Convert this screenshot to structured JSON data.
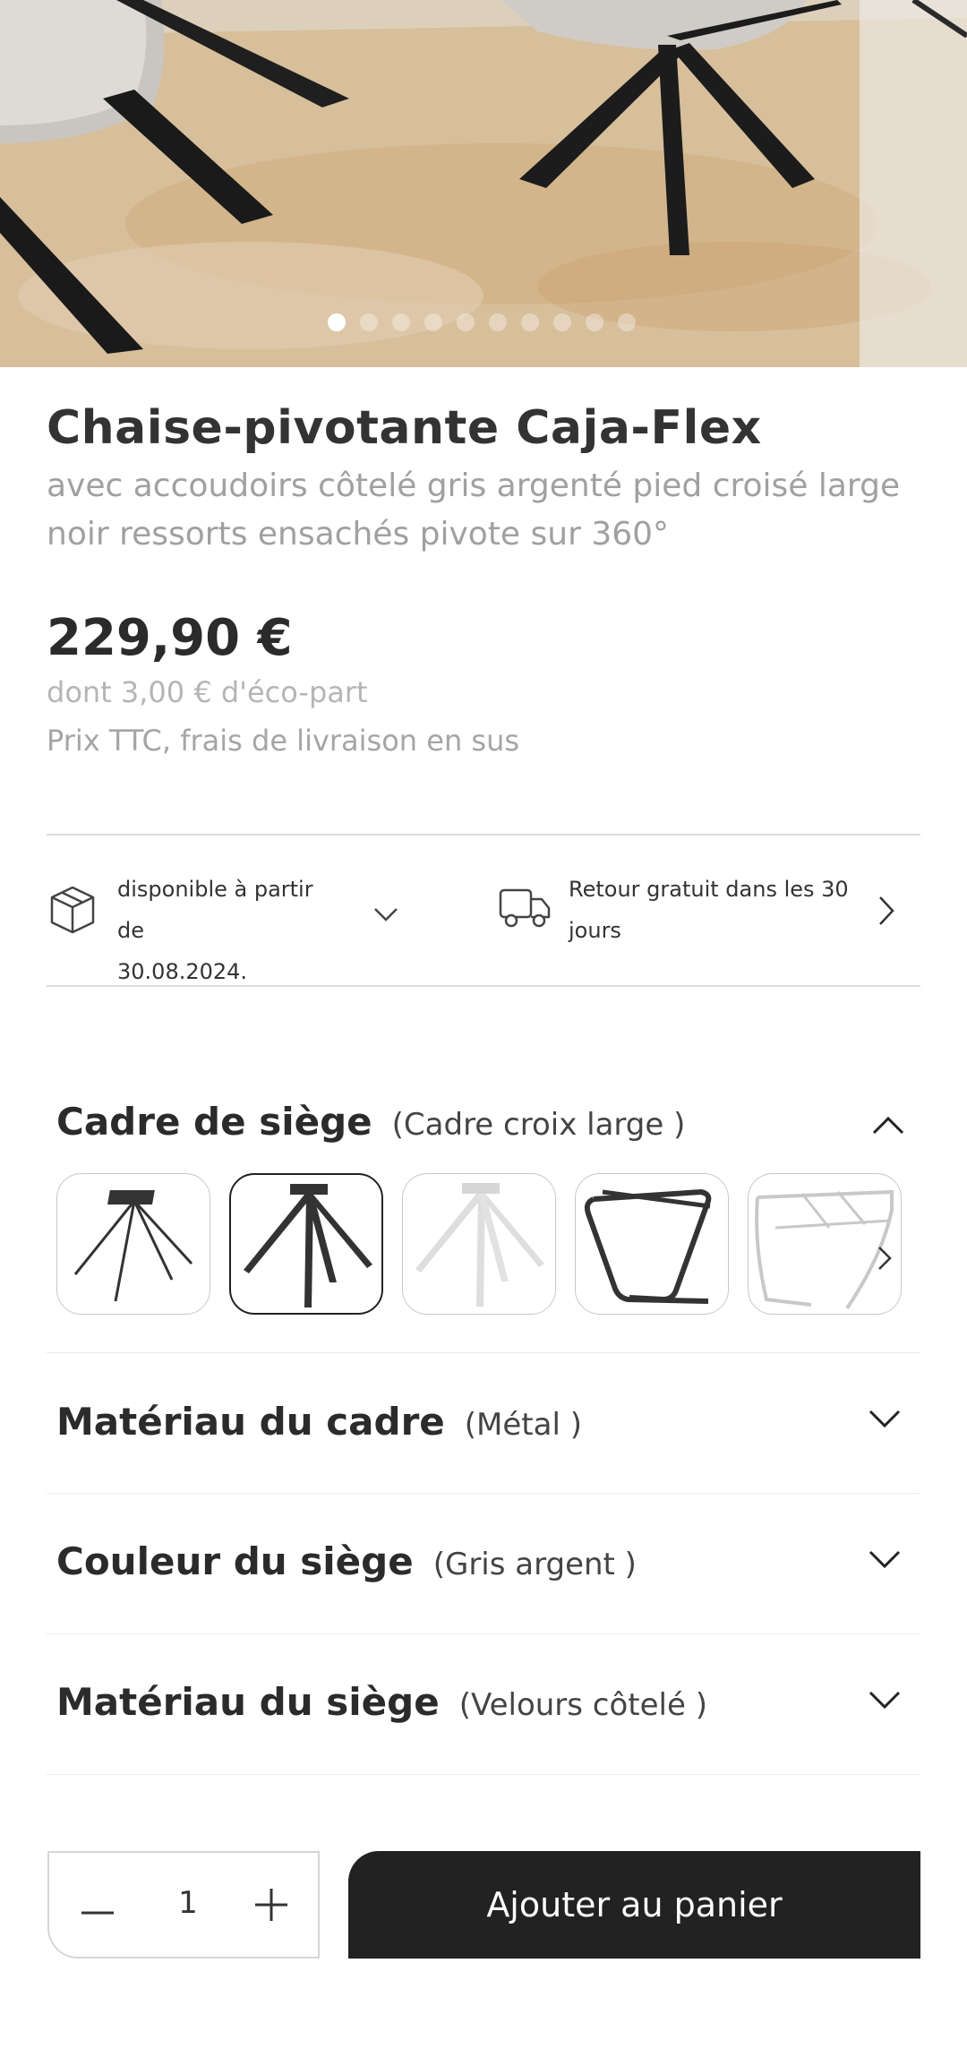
{
  "product": {
    "title": "Chaise-pivotante Caja-Flex",
    "subtitle": "avec accoudoirs côtelé gris argenté pied croisé large noir ressorts ensachés pivote sur 360°",
    "price": "229,90 €",
    "eco_part": "dont 3,00 € d'éco-part",
    "tax_note": "Prix TTC, frais de livraison en sus"
  },
  "gallery": {
    "image_count": 10,
    "active_index": 0
  },
  "info": {
    "availability_line1": "disponible à partir de",
    "availability_line2": "30.08.2024.",
    "return_line1": "Retour gratuit dans les 30",
    "return_line2": "jours"
  },
  "options": [
    {
      "label": "Cadre de siège",
      "value": "(Cadre croix large )",
      "expanded": true
    },
    {
      "label": "Matériau du cadre",
      "value": "(Métal )",
      "expanded": false
    },
    {
      "label": "Couleur du siège",
      "value": "(Gris argent )",
      "expanded": false
    },
    {
      "label": "Matériau du siège",
      "value": "(Velours côtelé )",
      "expanded": false
    }
  ],
  "frame_swatches": [
    {
      "name": "cross-thin-black",
      "selected": false
    },
    {
      "name": "cross-wide-black",
      "selected": true
    },
    {
      "name": "cross-wide-white",
      "selected": false
    },
    {
      "name": "cantilever-black",
      "selected": false
    },
    {
      "name": "sled-white",
      "selected": false
    }
  ],
  "cart": {
    "quantity": "1",
    "add_label": "Ajouter au panier"
  },
  "icons": [
    "box-icon",
    "truck-icon",
    "chevron-down-icon",
    "chevron-right-icon",
    "chevron-up-icon",
    "minus-icon",
    "plus-icon"
  ],
  "colors": {
    "primary": "#222222",
    "muted_text": "#a0a0a0",
    "border": "#dcdcdc"
  }
}
